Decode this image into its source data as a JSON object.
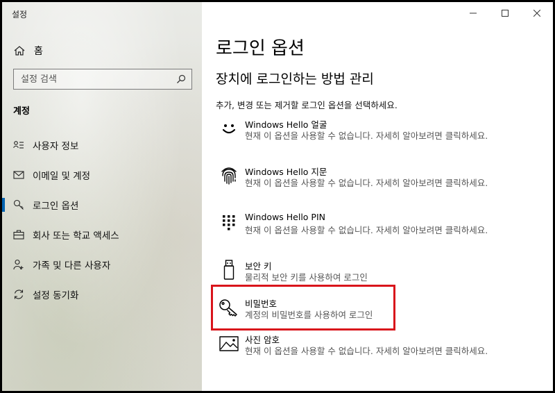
{
  "window": {
    "title": "설정"
  },
  "sidebar": {
    "home_label": "홈",
    "search_placeholder": "설정 검색",
    "section_title": "계정",
    "items": [
      {
        "label": "사용자 정보",
        "icon": "user-info-icon"
      },
      {
        "label": "이메일 및 계정",
        "icon": "mail-icon"
      },
      {
        "label": "로그인 옵션",
        "icon": "key-icon",
        "active": true
      },
      {
        "label": "회사 또는 학교 액세스",
        "icon": "briefcase-icon"
      },
      {
        "label": "가족 및 다른 사용자",
        "icon": "family-icon"
      },
      {
        "label": "설정 동기화",
        "icon": "sync-icon"
      }
    ]
  },
  "main": {
    "title": "로그인 옵션",
    "subheading": "장치에 로그인하는 방법 관리",
    "description": "추가, 변경 또는 제거할 로그인 옵션을 선택하세요.",
    "options": [
      {
        "title": "Windows Hello 얼굴",
        "desc": "현재 이 옵션을 사용할 수 없습니다. 자세히 알아보려면 클릭하세요.",
        "icon": "face-icon"
      },
      {
        "title": "Windows Hello 지문",
        "desc": "현재 이 옵션을 사용할 수 없습니다. 자세히 알아보려면 클릭하세요.",
        "icon": "fingerprint-icon"
      },
      {
        "title": "Windows Hello PIN",
        "desc": "현재 이 옵션을 사용할 수 없습니다. 자세히 알아보려면 클릭하세요.",
        "icon": "pin-keypad-icon"
      },
      {
        "title": "보안 키",
        "desc": "물리적 보안 키를 사용하여 로그인",
        "icon": "usb-key-icon"
      },
      {
        "title": "비밀번호",
        "desc": "계정의 비밀번호를 사용하여 로그인",
        "icon": "password-key-icon"
      },
      {
        "title": "사진 암호",
        "desc": "현재 이 옵션을 사용할 수 없습니다. 자세히 알아보려면 클릭하세요.",
        "icon": "picture-icon"
      }
    ]
  },
  "colors": {
    "accent": "#0063b1",
    "highlight": "#d9141b"
  }
}
